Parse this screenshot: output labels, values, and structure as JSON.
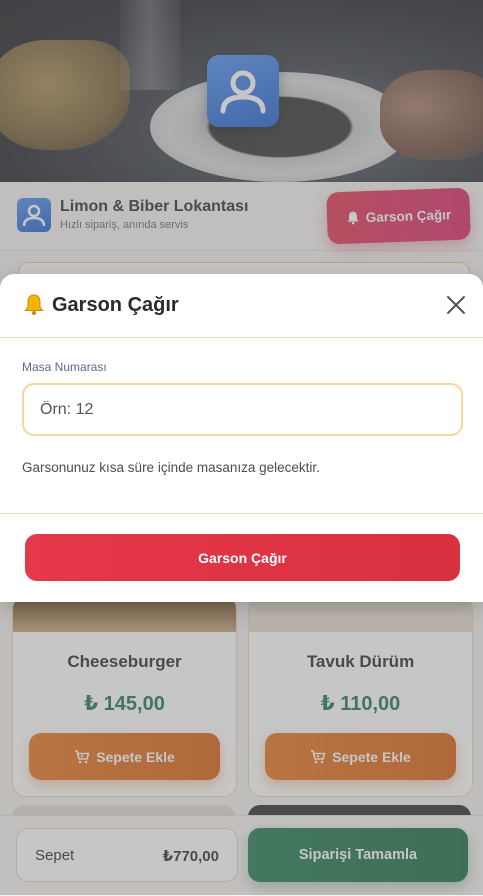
{
  "header": {
    "restaurant_name": "Limon & Biber Lokantası",
    "tagline": "Hızlı sipariş, anında servis",
    "call_waiter_label": "Garson Çağır"
  },
  "menu": {
    "items": [
      {
        "name": "Cheeseburger",
        "price": "₺ 145,00",
        "add_label": "Sepete Ekle"
      },
      {
        "name": "Tavuk Dürüm",
        "price": "₺ 110,00",
        "add_label": "Sepete Ekle"
      }
    ]
  },
  "cart": {
    "label": "Sepet",
    "total": "₺770,00",
    "checkout_label": "Siparişi Tamamla"
  },
  "modal": {
    "title": "Garson Çağır",
    "field_label": "Masa Numarası",
    "field_value": "",
    "field_placeholder": "Örn: 12",
    "hint": "Garsonunuz kısa süre içinde masanıza gelecektir.",
    "submit_label": "Garson Çağır"
  },
  "icons": {
    "bell": "bell-icon",
    "close": "close-icon",
    "cart": "cart-icon",
    "user": "user-avatar-icon"
  },
  "colors": {
    "accent_red": "#e5384a",
    "accent_orange": "#e7731c",
    "accent_green": "#1f7a4e",
    "price_teal": "#1f6f5c",
    "logo_blue": "#2f74e0"
  }
}
